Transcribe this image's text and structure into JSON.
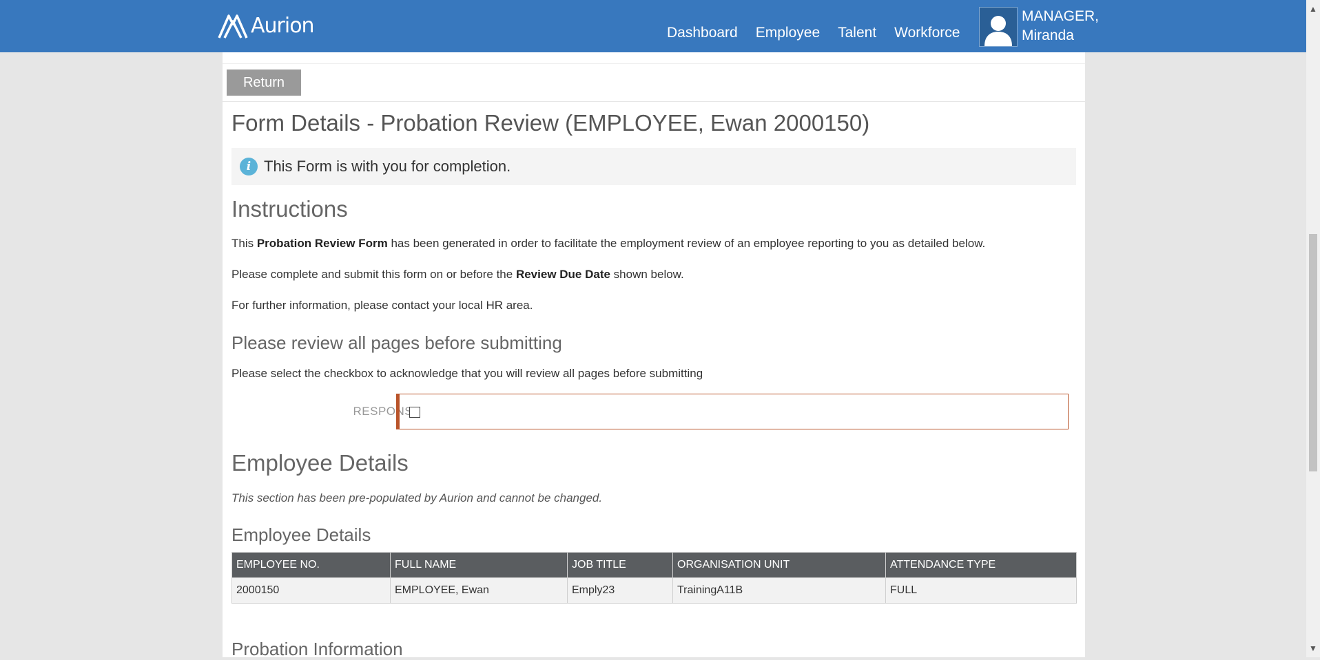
{
  "header": {
    "brand": "Aurion",
    "nav": [
      "Dashboard",
      "Employee",
      "Talent",
      "Workforce"
    ],
    "user": {
      "line1": "MANAGER,",
      "line2": "Miranda"
    }
  },
  "toolbar": {
    "return_label": "Return"
  },
  "page": {
    "title": "Form Details - Probation Review (EMPLOYEE, Ewan 2000150)",
    "info": "This Form is with you for completion."
  },
  "instructions": {
    "heading": "Instructions",
    "p1_pre": "This ",
    "p1_bold": "Probation Review Form",
    "p1_post": " has been generated in order to facilitate the employment review of an employee reporting to you as detailed below.",
    "p2_pre": "Please complete and submit this form on or before the ",
    "p2_bold": "Review Due Date",
    "p2_post": " shown below.",
    "p3": "For further information, please contact your local HR area."
  },
  "review": {
    "heading": "Please review all pages before submitting",
    "description": "Please select the checkbox to acknowledge that you will review all pages before submitting",
    "response_label": "RESPONSE",
    "checked": false
  },
  "employee_section": {
    "heading": "Employee Details",
    "note": "This section has been pre-populated by Aurion and cannot be changed.",
    "subheading": "Employee Details",
    "columns": [
      "EMPLOYEE NO.",
      "FULL NAME",
      "JOB TITLE",
      "ORGANISATION UNIT",
      "ATTENDANCE TYPE"
    ],
    "rows": [
      [
        "2000150",
        "EMPLOYEE, Ewan",
        "Emply23",
        "TrainingA11B",
        "FULL"
      ]
    ]
  },
  "probation": {
    "heading": "Probation Information"
  },
  "colors": {
    "header": "#3878be",
    "table_header": "#5a5d60",
    "response_border": "#b9542a",
    "info_icon": "#5bb3d8"
  }
}
